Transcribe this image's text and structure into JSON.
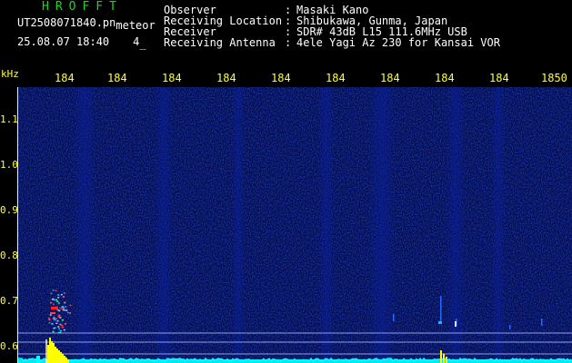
{
  "header": {
    "logo": "HROFFT",
    "filename_main": "UT2508071840.pn",
    "filename_suffix": "meteor",
    "datetime": "25.08.07 18:40",
    "page_number": "4"
  },
  "station_info": {
    "labels": [
      "Observer",
      "Receiving Location",
      "Receiver",
      "Receiving Antenna"
    ],
    "separator": ":",
    "values": [
      "Masaki Kano",
      "Shibukawa, Gunma, Japan",
      "SDR# 43dB L15 111.6MHz USB",
      "4ele Yagi Az 230 for Kansai VOR"
    ]
  },
  "axes": {
    "y_unit": "kHz",
    "y_ticks": [
      "1.1",
      "1.0",
      "0.9",
      "0.8",
      "0.7",
      "0.6"
    ],
    "x_ticks": [
      "184",
      "184",
      "184",
      "184",
      "184",
      "184",
      "184",
      "184",
      "184",
      "1850"
    ]
  },
  "colors": {
    "background": "#000000",
    "logo": "#23d223",
    "axis_text": "#ffff3c",
    "header_text": "#ffffff",
    "spectrogram_base": "#010a4a",
    "marker_line": "#a8b4ff",
    "signal_yellow": "#ffff00",
    "signal_cyan": "#00ffff"
  }
}
